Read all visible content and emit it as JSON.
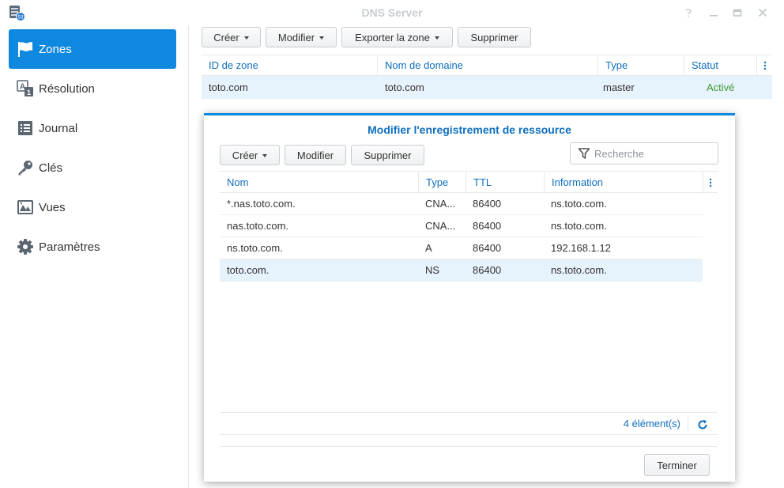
{
  "window": {
    "title": "DNS Server",
    "controls": [
      "help-icon",
      "minimize-icon",
      "maximize-icon",
      "close-icon"
    ]
  },
  "colors": {
    "accent": "#0f88e0",
    "link_blue": "#0f6fbf",
    "status_green": "#3d9c2e",
    "selected_row": "#e6f2fc"
  },
  "sidebar": {
    "items": [
      {
        "label": "Zones",
        "icon": "flag-icon",
        "active": true
      },
      {
        "label": "Résolution",
        "icon": "resolution-icon",
        "active": false
      },
      {
        "label": "Journal",
        "icon": "log-list-icon",
        "active": false
      },
      {
        "label": "Clés",
        "icon": "key-icon",
        "active": false
      },
      {
        "label": "Vues",
        "icon": "views-icon",
        "active": false
      },
      {
        "label": "Paramètres",
        "icon": "gear-icon",
        "active": false
      }
    ]
  },
  "toolbar": {
    "create_label": "Créer",
    "edit_label": "Modifier",
    "export_label": "Exporter la zone",
    "delete_label": "Supprimer"
  },
  "zone_table": {
    "columns": [
      "ID de zone",
      "Nom de domaine",
      "Type",
      "Statut"
    ],
    "rows": [
      {
        "zone_id": "toto.com",
        "domain": "toto.com",
        "type": "master",
        "status": "Activé"
      }
    ]
  },
  "modal": {
    "title": "Modifier l'enregistrement de ressource",
    "toolbar": {
      "create_label": "Créer",
      "edit_label": "Modifier",
      "delete_label": "Supprimer"
    },
    "search": {
      "placeholder": "Recherche"
    },
    "table": {
      "columns": [
        "Nom",
        "Type",
        "TTL",
        "Information"
      ],
      "rows": [
        {
          "name": "*.nas.toto.com.",
          "type": "CNA...",
          "ttl": "86400",
          "info": "ns.toto.com.",
          "selected": false
        },
        {
          "name": "nas.toto.com.",
          "type": "CNA...",
          "ttl": "86400",
          "info": "ns.toto.com.",
          "selected": false
        },
        {
          "name": "ns.toto.com.",
          "type": "A",
          "ttl": "86400",
          "info": "192.168.1.12",
          "selected": false
        },
        {
          "name": "toto.com.",
          "type": "NS",
          "ttl": "86400",
          "info": "ns.toto.com.",
          "selected": true
        }
      ]
    },
    "count_label": "4 élément(s)",
    "finish_label": "Terminer"
  }
}
